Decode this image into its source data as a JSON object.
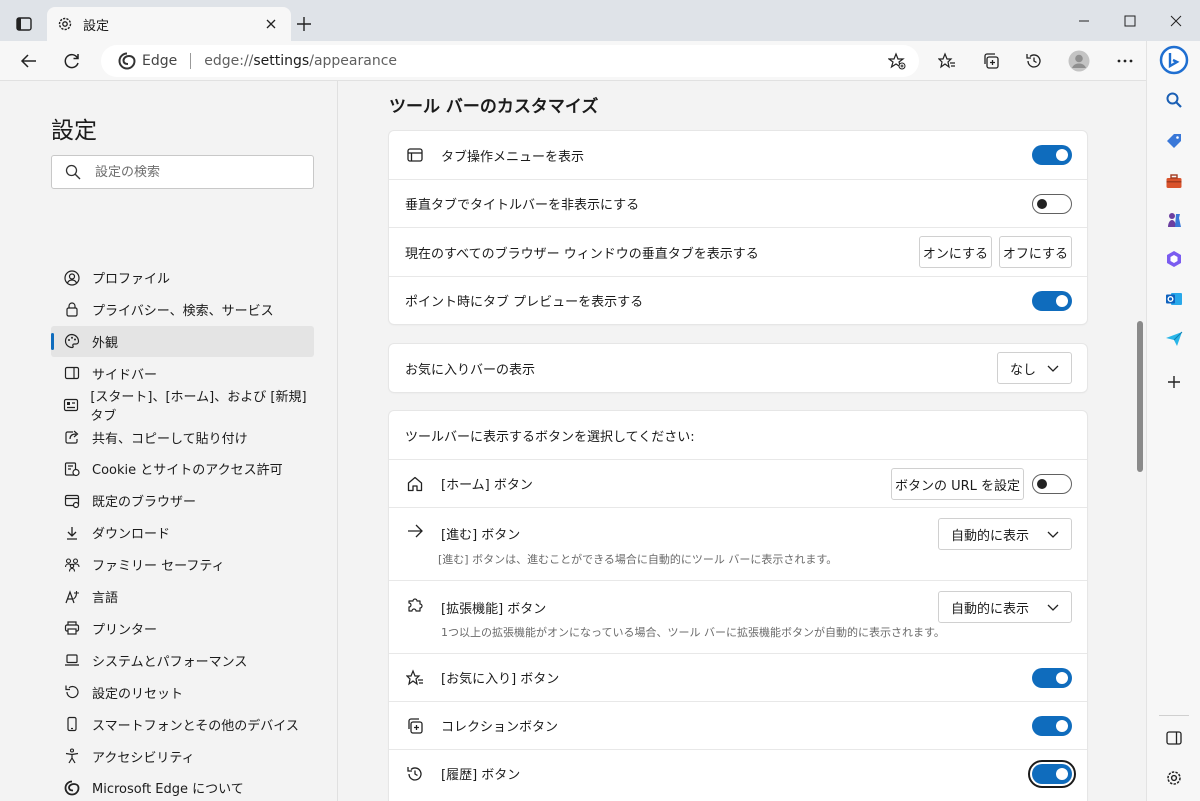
{
  "tab": {
    "title": "設定"
  },
  "address": {
    "site_name": "Edge",
    "url_scheme": "edge://",
    "url_host": "settings",
    "url_path": "/appearance"
  },
  "nav": {
    "title": "設定",
    "search_placeholder": "設定の検索",
    "items": [
      {
        "label": "プロファイル",
        "icon": "profile-icon"
      },
      {
        "label": "プライバシー、検索、サービス",
        "icon": "lock-icon"
      },
      {
        "label": "外観",
        "icon": "palette-icon",
        "active": true
      },
      {
        "label": "サイドバー",
        "icon": "sidebar-icon"
      },
      {
        "label": "[スタート]、[ホーム]、および [新規] タブ",
        "icon": "home-tab-icon"
      },
      {
        "label": "共有、コピーして貼り付け",
        "icon": "share-icon"
      },
      {
        "label": "Cookie とサイトのアクセス許可",
        "icon": "cookie-icon"
      },
      {
        "label": "既定のブラウザー",
        "icon": "browser-icon"
      },
      {
        "label": "ダウンロード",
        "icon": "download-icon"
      },
      {
        "label": "ファミリー セーフティ",
        "icon": "family-icon"
      },
      {
        "label": "言語",
        "icon": "language-icon"
      },
      {
        "label": "プリンター",
        "icon": "printer-icon"
      },
      {
        "label": "システムとパフォーマンス",
        "icon": "laptop-icon"
      },
      {
        "label": "設定のリセット",
        "icon": "reset-icon"
      },
      {
        "label": "スマートフォンとその他のデバイス",
        "icon": "phone-icon"
      },
      {
        "label": "アクセシビリティ",
        "icon": "accessibility-icon"
      },
      {
        "label": "Microsoft Edge について",
        "icon": "edge-logo-icon"
      }
    ]
  },
  "main": {
    "section_title": "ツール バーのカスタマイズ",
    "tab_card": {
      "show_tab_actions": {
        "label": "タブ操作メニューを表示",
        "on": true
      },
      "hide_titlebar": {
        "label": "垂直タブでタイトルバーを非表示にする",
        "on": false
      },
      "vertical_tabs_all": {
        "label": "現在のすべてのブラウザー ウィンドウの垂直タブを表示する",
        "on_button": "オンにする",
        "off_button": "オフにする"
      },
      "tab_preview": {
        "label": "ポイント時にタブ プレビューを表示する",
        "on": true
      }
    },
    "favorites_bar": {
      "label": "お気に入りバーの表示",
      "value": "なし"
    },
    "buttons_card": {
      "heading": "ツールバーに表示するボタンを選択してください:",
      "home": {
        "label": "[ホーム] ボタン",
        "url_button": "ボタンの URL を設定",
        "on": false
      },
      "forward": {
        "label": "[進む] ボタン",
        "desc": "[進む] ボタンは、進むことができる場合に自動的にツール バーに表示されます。",
        "value": "自動的に表示"
      },
      "extensions": {
        "label": "[拡張機能] ボタン",
        "desc": "1つ以上の拡張機能がオンになっている場合、ツール バーに拡張機能ボタンが自動的に表示されます。",
        "value": "自動的に表示"
      },
      "favorites": {
        "label": "[お気に入り] ボタン",
        "on": true
      },
      "collections": {
        "label": "コレクションボタン",
        "on": true
      },
      "history": {
        "label": "[履歴] ボタン",
        "on": true
      }
    }
  },
  "colors": {
    "accent": "#0f6cbd",
    "background": "#f3f3f3",
    "card": "#ffffff"
  }
}
